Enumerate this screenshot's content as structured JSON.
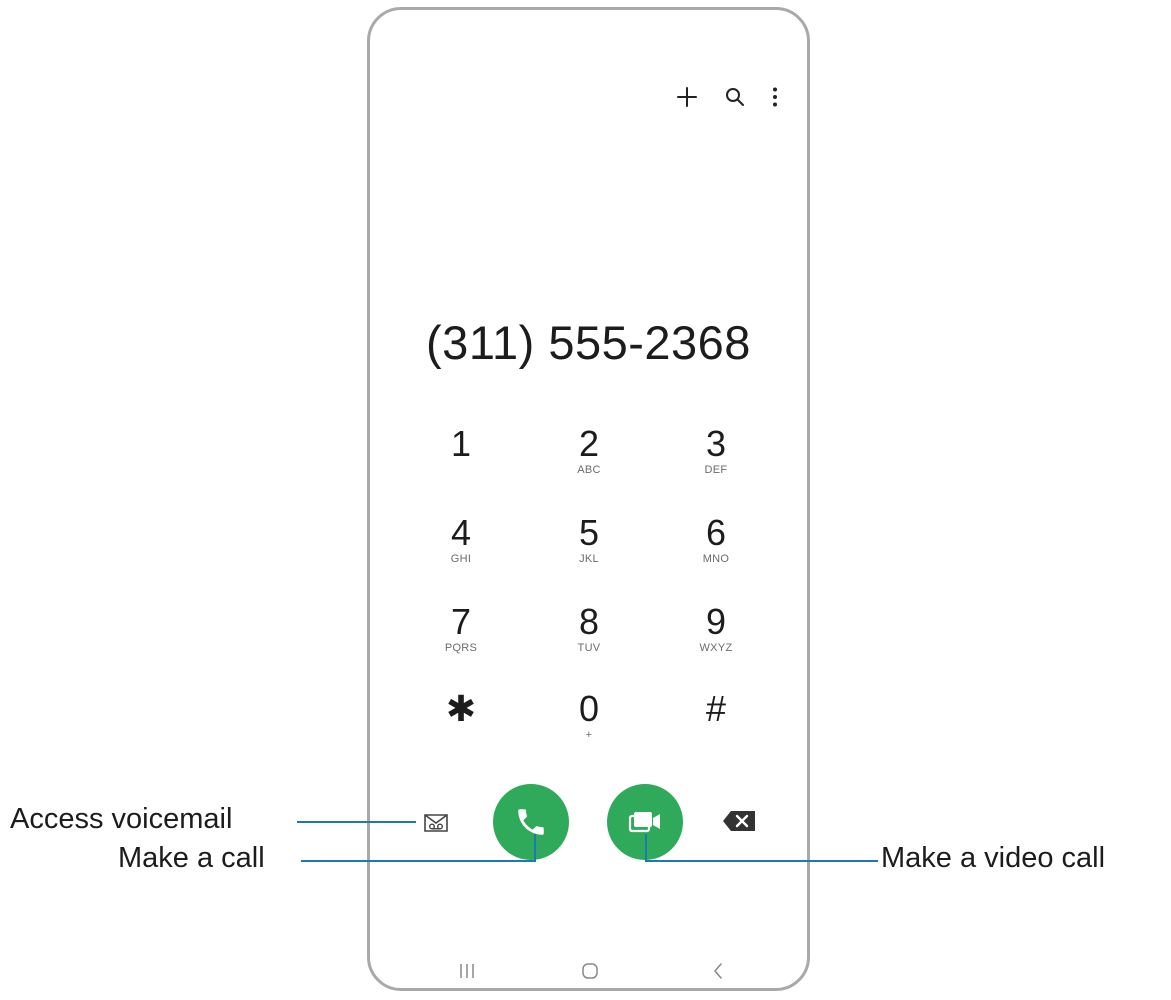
{
  "dialer": {
    "number": "(311) 555-2368",
    "actions": {
      "add_icon": "plus-icon",
      "search_icon": "search-icon",
      "more_icon": "more-vertical-icon"
    },
    "keys": [
      {
        "digit": "1",
        "letters": ""
      },
      {
        "digit": "2",
        "letters": "ABC"
      },
      {
        "digit": "3",
        "letters": "DEF"
      },
      {
        "digit": "4",
        "letters": "GHI"
      },
      {
        "digit": "5",
        "letters": "JKL"
      },
      {
        "digit": "6",
        "letters": "MNO"
      },
      {
        "digit": "7",
        "letters": "PQRS"
      },
      {
        "digit": "8",
        "letters": "TUV"
      },
      {
        "digit": "9",
        "letters": "WXYZ"
      },
      {
        "digit": "✱",
        "letters": ""
      },
      {
        "digit": "0",
        "letters": "+"
      },
      {
        "digit": "#",
        "letters": ""
      }
    ],
    "bottom": {
      "voicemail_icon": "voicemail-icon",
      "call_icon": "phone-icon",
      "video_icon": "video-camera-icon",
      "backspace_icon": "backspace-icon",
      "call_color": "#2eaa5a"
    }
  },
  "navbar": {
    "recents_icon": "recents-icon",
    "home_icon": "home-icon",
    "back_icon": "back-icon"
  },
  "callouts": {
    "voicemail": "Access voicemail",
    "call": "Make a call",
    "video": "Make a video call",
    "line_color": "#1f78b4"
  }
}
